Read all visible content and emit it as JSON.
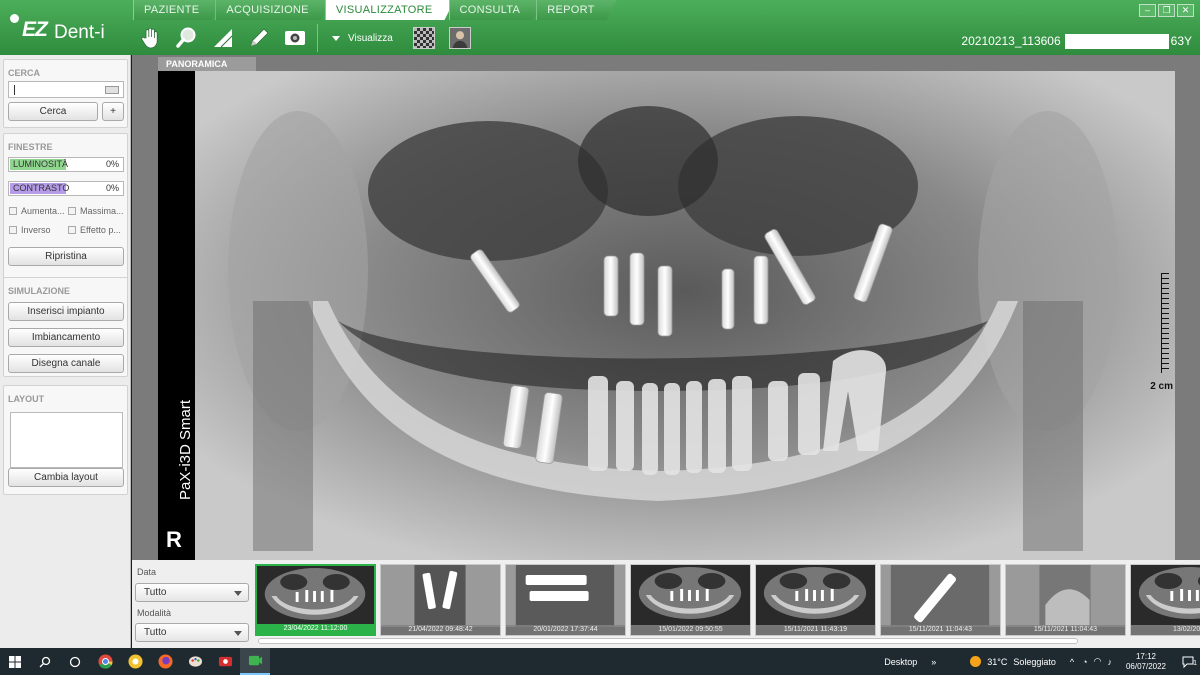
{
  "app": {
    "logo_ez": "EZ",
    "logo_dent": "Dent-i"
  },
  "tabs": [
    {
      "label": "PAZIENTE",
      "active": false
    },
    {
      "label": "ACQUISIZIONE",
      "active": false
    },
    {
      "label": "VISUALIZZATORE",
      "active": true
    },
    {
      "label": "CONSULTA",
      "active": false
    },
    {
      "label": "REPORT",
      "active": false
    }
  ],
  "toolbar": {
    "tools": [
      "hand-icon",
      "magnifier-icon",
      "triangle-icon",
      "pencil-icon",
      "camera-icon"
    ],
    "view_menu_label": "Visualizza"
  },
  "patient": {
    "id": "20210213_113606",
    "age": "63Y"
  },
  "left_panel": {
    "search": {
      "title": "CERCA",
      "search_button": "Cerca",
      "add_button": "+"
    },
    "windows": {
      "title": "FINESTRE",
      "brightness_label": "LUMINOSITÀ",
      "brightness_value": "0%",
      "contrast_label": "CONTRASTO",
      "contrast_value": "0%",
      "checkboxes": [
        "Aumenta...",
        "Massima...",
        "Inverso",
        "Effetto p..."
      ],
      "reset_button": "Ripristina"
    },
    "simulation": {
      "title": "SIMULAZIONE",
      "buttons": [
        "Inserisci impianto",
        "Imbiancamento",
        "Disegna canale"
      ]
    },
    "layout": {
      "title": "LAYOUT",
      "change_button": "Cambia layout"
    }
  },
  "viewer": {
    "image_title": "PANORAMICA",
    "device_label": "PaX-i3D Smart",
    "side_marker": "R",
    "ruler_label": "2 cm"
  },
  "filters": {
    "date_label": "Data",
    "date_value": "Tutto",
    "modality_label": "Modalità",
    "modality_value": "Tutto"
  },
  "thumbnails": [
    {
      "date": "23/04/2022 11:12:00",
      "kind": "pano",
      "selected": true
    },
    {
      "date": "21/04/2022 09:48:42",
      "kind": "periapical",
      "selected": false
    },
    {
      "date": "20/01/2022 17:37:44",
      "kind": "implant",
      "selected": false
    },
    {
      "date": "15/01/2022 09:50:55",
      "kind": "pano",
      "selected": false
    },
    {
      "date": "15/11/2021 11:43:19",
      "kind": "pano",
      "selected": false
    },
    {
      "date": "15/11/2021 11:04:43",
      "kind": "screw",
      "selected": false
    },
    {
      "date": "15/11/2021 11:04:43",
      "kind": "periapical2",
      "selected": false
    },
    {
      "date": "13/02/2021",
      "kind": "pano",
      "selected": false
    }
  ],
  "taskbar": {
    "desktop_label": "Desktop",
    "temperature": "31°C",
    "weather": "Soleggiato",
    "time": "17:12",
    "date": "06/07/2022",
    "notification_count": "1"
  }
}
